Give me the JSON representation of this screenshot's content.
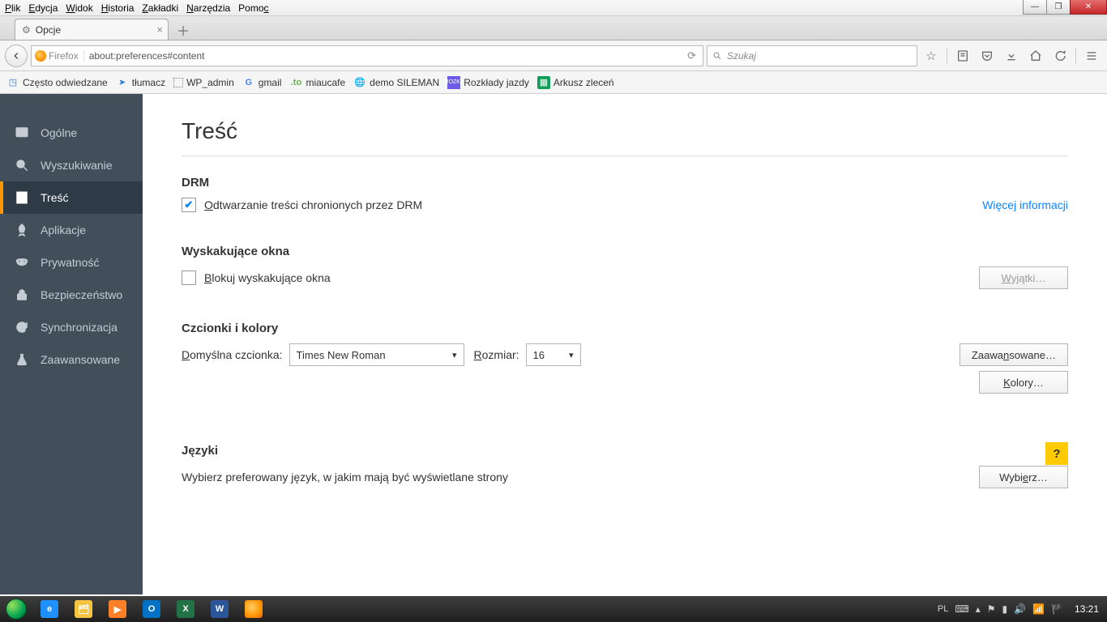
{
  "menubar": {
    "items": [
      "Plik",
      "Edycja",
      "Widok",
      "Historia",
      "Zakładki",
      "Narzędzia",
      "Pomoc"
    ]
  },
  "window_buttons": {
    "min": "—",
    "max": "❐",
    "close": "✕"
  },
  "tab": {
    "title": "Opcje"
  },
  "urlbar": {
    "identity": "Firefox",
    "url": "about:preferences#content"
  },
  "searchbar": {
    "placeholder": "Szukaj"
  },
  "bookmarks": [
    {
      "label": "Często odwiedzane"
    },
    {
      "label": "tłumacz"
    },
    {
      "label": "WP_admin"
    },
    {
      "label": "gmail"
    },
    {
      "label": "miaucafe"
    },
    {
      "label": "demo SILEMAN"
    },
    {
      "label": "Rozkłady jazdy"
    },
    {
      "label": "Arkusz zleceń"
    }
  ],
  "sidebar": {
    "items": [
      {
        "label": "Ogólne"
      },
      {
        "label": "Wyszukiwanie"
      },
      {
        "label": "Treść"
      },
      {
        "label": "Aplikacje"
      },
      {
        "label": "Prywatność"
      },
      {
        "label": "Bezpieczeństwo"
      },
      {
        "label": "Synchronizacja"
      },
      {
        "label": "Zaawansowane"
      }
    ]
  },
  "page": {
    "title": "Treść",
    "drm": {
      "heading": "DRM",
      "checkbox_label": "Odtwarzanie treści chronionych przez DRM",
      "more_info": "Więcej informacji"
    },
    "popups": {
      "heading": "Wyskakujące okna",
      "checkbox_label": "Blokuj wyskakujące okna",
      "exceptions_btn": "Wyjątki…"
    },
    "fonts": {
      "heading": "Czcionki i kolory",
      "default_font_label": "Domyślna czcionka:",
      "default_font_value": "Times New Roman",
      "size_label": "Rozmiar:",
      "size_value": "16",
      "advanced_btn": "Zaawansowane…",
      "colors_btn": "Kolory…"
    },
    "languages": {
      "heading": "Języki",
      "desc": "Wybierz preferowany język, w jakim mają być wyświetlane strony",
      "choose_btn": "Wybierz…"
    },
    "help": "?"
  },
  "taskbar": {
    "lang": "PL",
    "clock": "13:21"
  }
}
